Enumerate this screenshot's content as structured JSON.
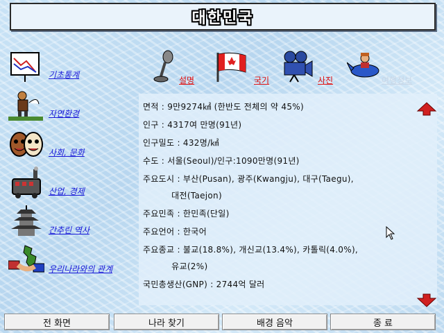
{
  "window": {
    "title": "대한민국"
  },
  "left_nav": [
    {
      "label": "기초통계",
      "icon": "chart-icon"
    },
    {
      "label": "자연환경",
      "icon": "hiker-icon"
    },
    {
      "label": "사회, 문화",
      "icon": "masks-icon"
    },
    {
      "label": "산업, 경제",
      "icon": "factory-icon"
    },
    {
      "label": "간추린 역사",
      "icon": "pagoda-icon"
    },
    {
      "label": "우리나라와의 관계",
      "icon": "handshake-icon"
    }
  ],
  "top_menu": [
    {
      "label": "설명",
      "icon": "microphone-icon"
    },
    {
      "label": "국기",
      "icon": "flag-icon"
    },
    {
      "label": "사진",
      "icon": "camera-icon"
    },
    {
      "label": "여행정보",
      "icon": "airplane-icon"
    }
  ],
  "info": [
    "면적 : 9만9274㎢ (한반도 전체의 약 45%)",
    "인구 : 4317여 만명(91년)",
    "인구밀도 : 432명/㎢",
    "수도 : 서울(Seoul)/인구:1090만명(91년)",
    "주요도시 : 부산(Pusan), 광주(Kwangju), 대구(Taegu),",
    "          대전(Taejon)",
    "주요민족 : 한민족(단일)",
    "주요언어 : 한국어",
    "주요종교 : 불교(18.8%), 개신교(13.4%), 카톨릭(4.0%),",
    "          유교(2%)",
    "국민총생산(GNP) : 2744억 달러"
  ],
  "bottom_buttons": {
    "home": "전 화면",
    "find_country": "나라 찾기",
    "bgm": "배경 음악",
    "quit": "종 료"
  },
  "colors": {
    "link_blue": "#1818d8",
    "link_red": "#e01010",
    "disabled": "#c8d6e6"
  }
}
